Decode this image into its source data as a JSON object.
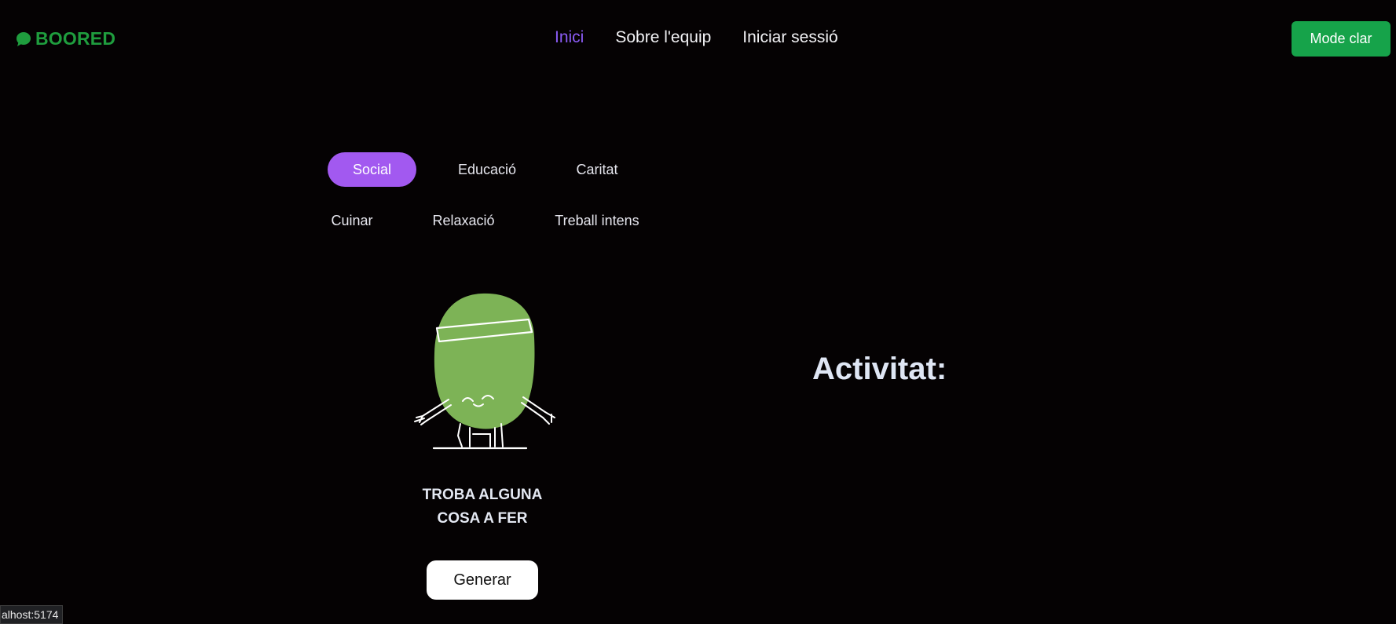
{
  "header": {
    "logo_text": "BOORED",
    "logo_icon": "speech-bubble-icon",
    "nav": [
      {
        "label": "Inici",
        "active": true
      },
      {
        "label": "Sobre l'equip",
        "active": false
      },
      {
        "label": "Iniciar sessió",
        "active": false
      }
    ],
    "mode_button": "Mode clar"
  },
  "categories": {
    "row1": [
      "Social",
      "Educació",
      "Caritat"
    ],
    "row2": [
      "Cuinar",
      "Relaxació",
      "Treball intens"
    ],
    "selected": "Social"
  },
  "main": {
    "illustration": "mascot-exercising-illustration",
    "find_line1": "TROBA ALGUNA",
    "find_line2": "COSA A FER",
    "generate_button": "Generar",
    "activity_title": "Activitat:"
  },
  "status_bar": {
    "url": "alhost:5174"
  },
  "colors": {
    "background": "#050203",
    "brand_green": "#1f9d3e",
    "accent_purple": "#a259f0",
    "nav_active": "#8b5cf6",
    "mode_button": "#16a34a",
    "mascot": "#7db356"
  }
}
